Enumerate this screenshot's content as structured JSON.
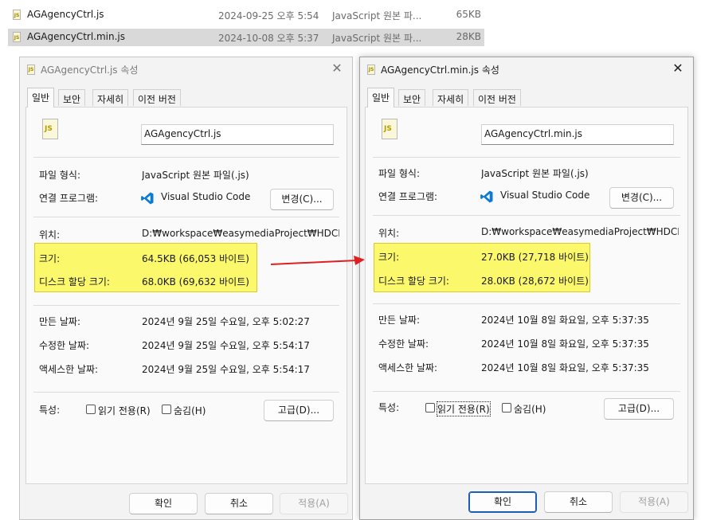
{
  "files": [
    {
      "name": "AGAgencyCtrl.js",
      "date": "2024-09-25 오후 5:54",
      "type": "JavaScript 원본 파...",
      "size": "65KB",
      "selected": false
    },
    {
      "name": "AGAgencyCtrl.min.js",
      "date": "2024-10-08 오후 5:37",
      "type": "JavaScript 원본 파...",
      "size": "28KB",
      "selected": true
    }
  ],
  "icon_badge": "JS",
  "dialogs": [
    {
      "title": "AGAgencyCtrl.js 속성",
      "tabs": [
        "일반",
        "보안",
        "자세히",
        "이전 버전"
      ],
      "filename": "AGAgencyCtrl.js",
      "type_label": "파일 형식:",
      "type_value": "JavaScript 원본 파일(.js)",
      "openwith_label": "연결 프로그램:",
      "openwith_value": "Visual Studio Code",
      "change_button": "변경(C)...",
      "location_label": "위치:",
      "location_value": "D:₩workspace₩easymediaProject₩HDCE₩client",
      "size_label": "크기:",
      "size_value": "64.5KB (66,053 바이트)",
      "disk_label": "디스크 할당 크기:",
      "disk_value": "68.0KB (69,632 바이트)",
      "created_label": "만든 날짜:",
      "created_value": "2024년 9월 25일 수요일, 오후 5:02:27",
      "modified_label": "수정한 날짜:",
      "modified_value": "2024년 9월 25일 수요일, 오후 5:54:17",
      "accessed_label": "액세스한 날짜:",
      "accessed_value": "2024년 9월 25일 수요일, 오후 5:54:17",
      "attr_label": "특성:",
      "readonly_label": "읽기 전용(R)",
      "hidden_label": "숨김(H)",
      "advanced_button": "고급(D)...",
      "ok": "확인",
      "cancel": "취소",
      "apply": "적용(A)"
    },
    {
      "title": "AGAgencyCtrl.min.js 속성",
      "tabs": [
        "일반",
        "보안",
        "자세히",
        "이전 버전"
      ],
      "filename": "AGAgencyCtrl.min.js",
      "type_label": "파일 형식:",
      "type_value": "JavaScript 원본 파일(.js)",
      "openwith_label": "연결 프로그램:",
      "openwith_value": "Visual Studio Code",
      "change_button": "변경(C)...",
      "location_label": "위치:",
      "location_value": "D:₩workspace₩easymediaProject₩HDCE₩client",
      "size_label": "크기:",
      "size_value": "27.0KB (27,718 바이트)",
      "disk_label": "디스크 할당 크기:",
      "disk_value": "28.0KB (28,672 바이트)",
      "created_label": "만든 날짜:",
      "created_value": "2024년 10월 8일 화요일, 오후 5:37:35",
      "modified_label": "수정한 날짜:",
      "modified_value": "2024년 10월 8일 화요일, 오후 5:37:35",
      "accessed_label": "액세스한 날짜:",
      "accessed_value": "2024년 10월 8일 화요일, 오후 5:37:35",
      "attr_label": "특성:",
      "readonly_label": "읽기 전용(R)",
      "hidden_label": "숨김(H)",
      "advanced_button": "고급(D)...",
      "ok": "확인",
      "cancel": "취소",
      "apply": "적용(A)"
    }
  ],
  "colors": {
    "highlight": "#fbf86c",
    "arrow": "#e02020",
    "primary_border": "#1b5fb4",
    "vscode_blue": "#0a7ad4"
  }
}
